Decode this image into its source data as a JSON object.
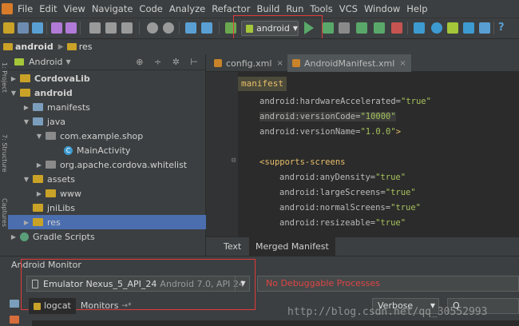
{
  "menubar": {
    "items": [
      "File",
      "Edit",
      "View",
      "Navigate",
      "Code",
      "Analyze",
      "Refactor",
      "Build",
      "Run",
      "Tools",
      "VCS",
      "Window",
      "Help"
    ]
  },
  "toolbar": {
    "run_config": "android"
  },
  "breadcrumb": {
    "items": [
      "android",
      "res"
    ]
  },
  "leftstrip": {
    "labels": [
      "1: Project",
      "7: Structure",
      "Captures"
    ]
  },
  "project_panel": {
    "view_mode": "Android",
    "tree": [
      {
        "label": "CordovaLib",
        "bold": true
      },
      {
        "label": "android",
        "bold": true
      },
      {
        "label": "manifests"
      },
      {
        "label": "java"
      },
      {
        "label": "com.example.shop"
      },
      {
        "label": "MainActivity"
      },
      {
        "label": "org.apache.cordova.whitelist"
      },
      {
        "label": "assets"
      },
      {
        "label": "www"
      },
      {
        "label": "jniLibs"
      },
      {
        "label": "res",
        "selected": true
      },
      {
        "label": "Gradle Scripts"
      }
    ]
  },
  "editor": {
    "tabs": [
      "config.xml",
      "AndroidManifest.xml"
    ],
    "breadcrumb_tag": "manifest",
    "lines": [
      {
        "attr": "android:hardwareAccelerated=",
        "val": "\"true\"",
        "tail": ""
      },
      {
        "attr": "android:versionCode=",
        "val": "\"10000\"",
        "tail": ""
      },
      {
        "attr": "android:versionName=",
        "val": "\"1.0.0\"",
        "tail": ">"
      },
      {
        "tag": "<supports-screens",
        "val": "",
        "tail": ""
      },
      {
        "attr": "android:anyDensity=",
        "val": "\"true\"",
        "tail": ""
      },
      {
        "attr": "android:largeScreens=",
        "val": "\"true\"",
        "tail": ""
      },
      {
        "attr": "android:normalScreens=",
        "val": "\"true\"",
        "tail": ""
      },
      {
        "attr": "android:resizeable=",
        "val": "\"true\"",
        "tail": ""
      }
    ],
    "bottom_tabs": [
      "Text",
      "Merged Manifest"
    ]
  },
  "monitor": {
    "title": "Android Monitor",
    "device_name": "Emulator Nexus_5_API_24",
    "device_version": "Android 7.0, API 24",
    "process": "No Debuggable Processes",
    "tabs": [
      "logcat",
      "Monitors"
    ],
    "log_level": "Verbose",
    "search_prefix": "Q",
    "watermark": "http://blog.csdn.net/qq_30552993"
  },
  "colors": {
    "highlight_box": "#e03a3a",
    "selection": "#4b6eaf",
    "error_text": "#e04444"
  }
}
